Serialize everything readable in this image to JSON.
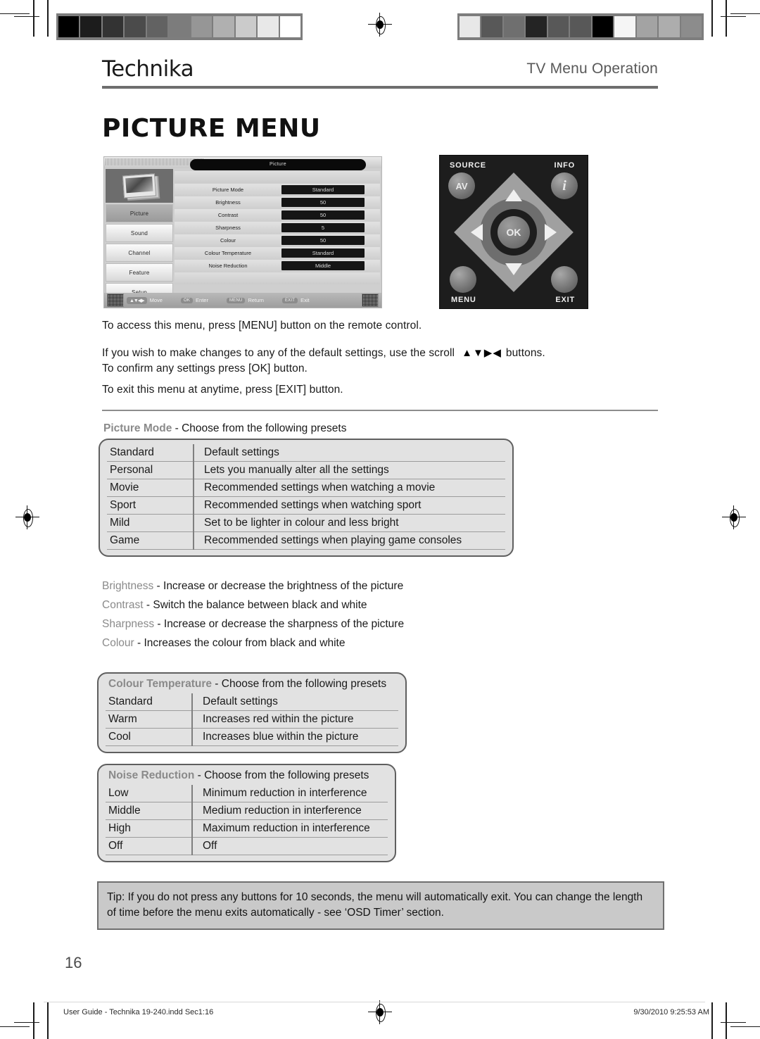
{
  "header": {
    "brand": "Technika",
    "section": "TV Menu Operation",
    "title": "PICTURE MENU"
  },
  "osd": {
    "title": "Picture",
    "sidebar_items": [
      "Picture",
      "Sound",
      "Channel",
      "Feature",
      "Setup"
    ],
    "active_sidebar_item": "Picture",
    "rows": [
      {
        "label": "Picture Mode",
        "value": "Standard"
      },
      {
        "label": "Brightness",
        "value": "50"
      },
      {
        "label": "Contrast",
        "value": "50"
      },
      {
        "label": "Sharpness",
        "value": "5"
      },
      {
        "label": "Colour",
        "value": "50"
      },
      {
        "label": "Colour Temperature",
        "value": "Standard"
      },
      {
        "label": "Noise Reduction",
        "value": "Middle"
      }
    ],
    "hints": [
      {
        "key": "▲▼◀▶",
        "action": "Move"
      },
      {
        "key": "OK",
        "action": "Enter"
      },
      {
        "key": "MENU",
        "action": "Return"
      },
      {
        "key": "EXIT",
        "action": "Exit"
      }
    ]
  },
  "remote": {
    "labels": {
      "source": "SOURCE",
      "info": "INFO",
      "menu": "MENU",
      "exit": "EXIT"
    },
    "buttons": {
      "av": "AV",
      "info": "i",
      "ok": "OK"
    }
  },
  "instructions": {
    "line1": "To access this menu, press [MENU] button on the remote control.",
    "line2a": "If you wish to make changes to any of the default settings, use the scroll",
    "scroll_arrows": "▲▼▶◀",
    "line2b": "buttons.",
    "line2c": "To confirm any settings press [OK] button.",
    "line3": "To exit this menu at anytime, press [EXIT] button."
  },
  "picture_mode": {
    "term": "Picture Mode",
    "caption_rest": " - Choose from the following presets",
    "rows": [
      {
        "name": "Standard",
        "desc": "Default settings"
      },
      {
        "name": "Personal",
        "desc": "Lets you manually alter all the settings"
      },
      {
        "name": "Movie",
        "desc": "Recommended settings when watching a movie"
      },
      {
        "name": "Sport",
        "desc": "Recommended settings when watching sport"
      },
      {
        "name": "Mild",
        "desc": "Set to be lighter in colour and less bright"
      },
      {
        "name": "Game",
        "desc": "Recommended settings when playing game consoles"
      }
    ]
  },
  "simple_settings": [
    {
      "term": "Brightness",
      "desc": " - Increase or decrease the brightness of the picture"
    },
    {
      "term": "Contrast",
      "desc": " - Switch the balance between black and white"
    },
    {
      "term": "Sharpness",
      "desc": " - Increase or decrease the sharpness of the picture"
    },
    {
      "term": "Colour",
      "desc": " - Increases the colour from black and white"
    }
  ],
  "colour_temperature": {
    "term": "Colour Temperature",
    "caption_rest": " - Choose from the following presets",
    "rows": [
      {
        "name": "Standard",
        "desc": "Default settings"
      },
      {
        "name": "Warm",
        "desc": "Increases red within the picture"
      },
      {
        "name": "Cool",
        "desc": "Increases blue within the picture"
      }
    ]
  },
  "noise_reduction": {
    "term": "Noise Reduction",
    "caption_rest": " - Choose from the following presets",
    "rows": [
      {
        "name": "Low",
        "desc": "Minimum reduction in interference"
      },
      {
        "name": "Middle",
        "desc": "Medium reduction in interference"
      },
      {
        "name": "High",
        "desc": "Maximum reduction in interference"
      },
      {
        "name": "Off",
        "desc": "Off"
      }
    ]
  },
  "tip": {
    "text": "Tip: If you do not press any buttons for 10 seconds, the menu will automatically exit. You can change the length of time before the menu exits automatically - see ‘OSD Timer’ section."
  },
  "page": {
    "number": "16",
    "footer_left": "User Guide - Technika 19-240.indd   Sec1:16",
    "footer_right": "9/30/2010   9:25:53 AM"
  },
  "calibration": {
    "left_strip": [
      "#000000",
      "#1c1c1c",
      "#333333",
      "#4b4b4b",
      "#626262",
      "#7c7c7c",
      "#969696",
      "#b0b0b0",
      "#cbcbcb",
      "#e8e8e8",
      "#ffffff"
    ],
    "right_strip": [
      "#e8e8e8",
      "#585858",
      "#6f6f6f",
      "#242424",
      "#585858",
      "#585858",
      "#000000",
      "#f5f5f5",
      "#a3a3a3",
      "#adadad",
      "#8c8c8c"
    ]
  }
}
